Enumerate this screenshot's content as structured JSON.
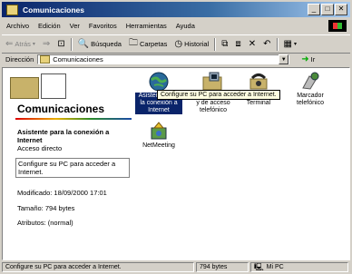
{
  "window": {
    "title": "Comunicaciones"
  },
  "menu": [
    "Archivo",
    "Edición",
    "Ver",
    "Favoritos",
    "Herramientas",
    "Ayuda"
  ],
  "toolbar": {
    "back": "Atrás",
    "search": "Búsqueda",
    "folders": "Carpetas",
    "history": "Historial"
  },
  "address": {
    "label": "Dirección",
    "value": "Comunicaciones",
    "go": "Ir"
  },
  "leftpane": {
    "title": "Comunicaciones",
    "selected_title": "Asistente para la conexión a Internet",
    "selected_type": "Acceso directo",
    "description": "Configure su PC para acceder a Internet.",
    "modified": "Modificado: 18/09/2000 17:01",
    "size": "Tamaño: 794 bytes",
    "attributes": "Atributos: (normal)"
  },
  "items": [
    {
      "label": "Asistente para la conexión a Internet",
      "icon": "globe-icon"
    },
    {
      "label": "Conexión de red y de acceso telefónico",
      "icon": "network-folder-icon"
    },
    {
      "label": "Hyper Terminal",
      "icon": "phone-icon"
    },
    {
      "label": "Marcador telefónico",
      "icon": "dialer-icon"
    },
    {
      "label": "NetMeeting",
      "icon": "netmeeting-icon"
    }
  ],
  "tooltip": "Configure su PC para acceder a Internet.",
  "status": {
    "text": "Configure su PC para acceder a Internet.",
    "size": "794 bytes",
    "zone": "Mi PC"
  },
  "colors": {
    "titlebar": "#0a246a",
    "selection": "#0a246a",
    "tooltip_bg": "#ffffe1"
  }
}
